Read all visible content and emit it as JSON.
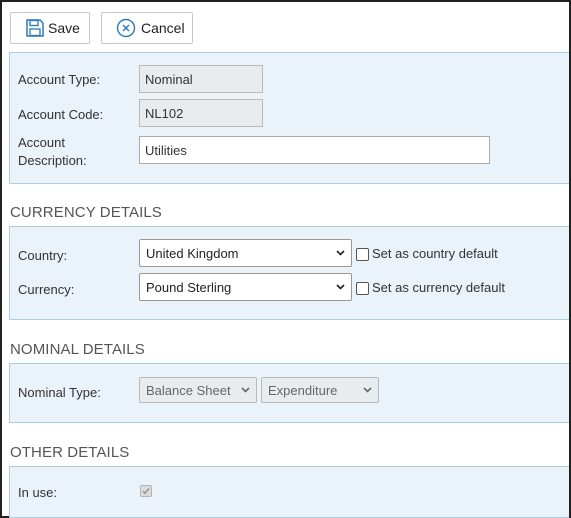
{
  "toolbar": {
    "save_label": "Save",
    "cancel_label": "Cancel"
  },
  "account": {
    "type_label": "Account Type:",
    "type_value": "Nominal",
    "code_label": "Account Code:",
    "code_value": "NL102",
    "desc_label_line1": "Account",
    "desc_label_line2": "Description:",
    "desc_value": "Utilities"
  },
  "currency": {
    "heading": "CURRENCY DETAILS",
    "country_label": "Country:",
    "country_value": "United Kingdom",
    "country_default_label": "Set as country default",
    "currency_label": "Currency:",
    "currency_value": "Pound Sterling",
    "currency_default_label": "Set as currency default"
  },
  "nominal": {
    "heading": "NOMINAL DETAILS",
    "type_label": "Nominal Type:",
    "type_value": "Balance Sheet",
    "category_value": "Expenditure"
  },
  "other": {
    "heading": "OTHER DETAILS",
    "in_use_label": "In use:",
    "in_use_checked": true
  },
  "colors": {
    "panel_bg": "#eaf3fa",
    "panel_border": "#a9cfe2",
    "icon_blue": "#2a7ab8"
  },
  "icons": [
    "save-icon",
    "cancel-icon",
    "chevron-down-icon",
    "checkbox-checked-icon"
  ]
}
